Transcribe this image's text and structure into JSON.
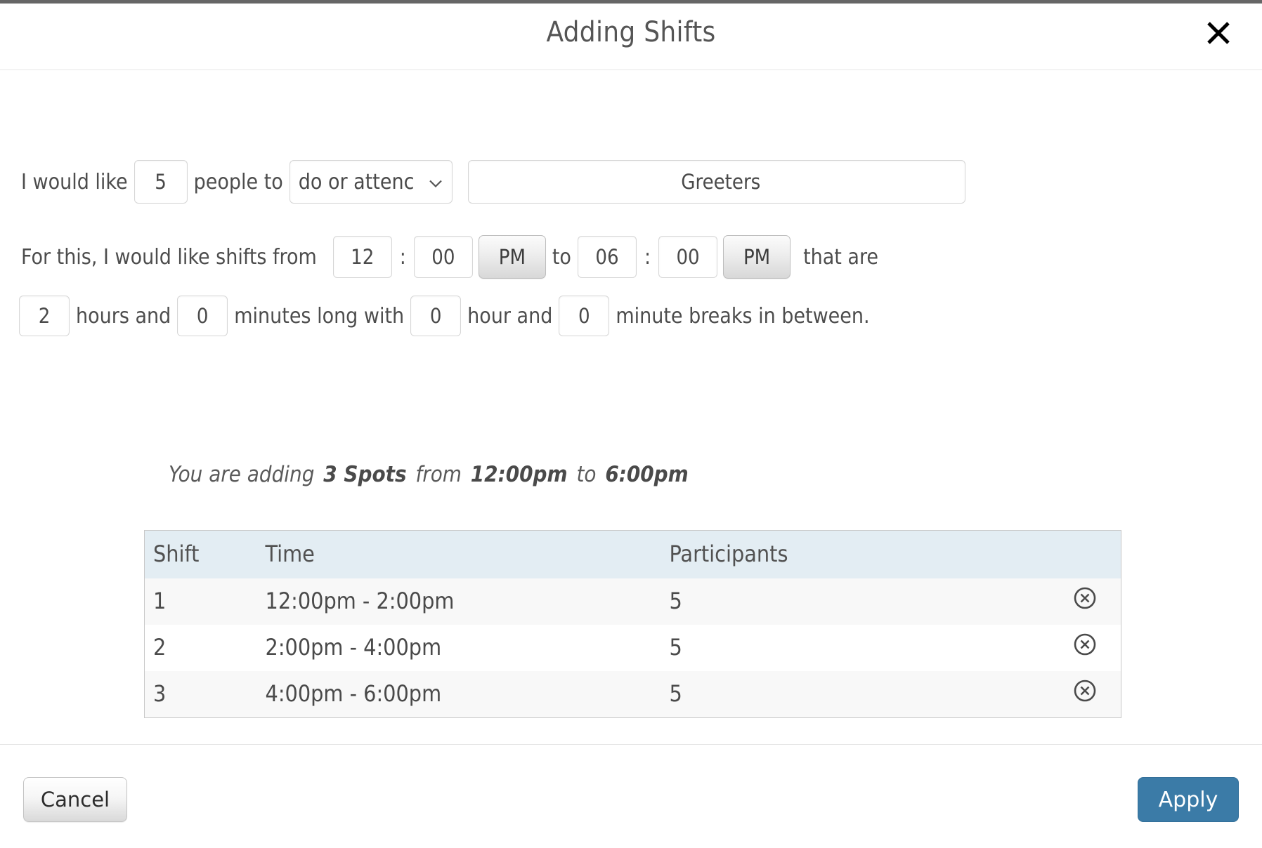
{
  "dialog": {
    "title": "Adding Shifts",
    "close_icon": "close-icon"
  },
  "form": {
    "line1": {
      "prefix": "I would like",
      "people_count": "5",
      "mid": "people to",
      "activity_kind_selected": "do or attenc",
      "activity_kind_options": [
        "do or attend"
      ],
      "caret_icon": "chevron-down-icon",
      "shift_title": "Greeters",
      "shift_title_placeholder": "Greeters"
    },
    "line2": {
      "prefix": "For this, I would like shifts from",
      "start_hour": "12",
      "start_colon": ":",
      "start_minute": "00",
      "start_meridiem": "PM",
      "between": "to",
      "end_hour": "06",
      "end_colon": ":",
      "end_minute": "00",
      "end_meridiem": "PM",
      "suffix": "that are"
    },
    "line3": {
      "duration_hours": "2",
      "hours_label": "hours and",
      "duration_minutes": "0",
      "minutes_label": "minutes long with",
      "break_hours": "0",
      "break_hour_label": "hour and",
      "break_minutes": "0",
      "break_minute_label": "minute breaks in between."
    }
  },
  "summary": {
    "lead": "You are adding",
    "spots": "3 Spots",
    "from_label": "from",
    "start_time": "12:00pm",
    "to_label": "to",
    "end_time": "6:00pm"
  },
  "table": {
    "columns": [
      "Shift",
      "Time",
      "Participants",
      ""
    ],
    "rows": [
      {
        "shift": "1",
        "time": "12:00pm - 2:00pm",
        "participants": "5",
        "remove_icon": "remove-circle-icon"
      },
      {
        "shift": "2",
        "time": "2:00pm - 4:00pm",
        "participants": "5",
        "remove_icon": "remove-circle-icon"
      },
      {
        "shift": "3",
        "time": "4:00pm - 6:00pm",
        "participants": "5",
        "remove_icon": "remove-circle-icon"
      }
    ]
  },
  "footer": {
    "cancel_label": "Cancel",
    "apply_label": "Apply"
  },
  "colors": {
    "apply_button": "#3b7ba7",
    "table_header": "#e3edf3",
    "table_row_alt": "#f8f8f8",
    "text": "#4d4d4d"
  }
}
